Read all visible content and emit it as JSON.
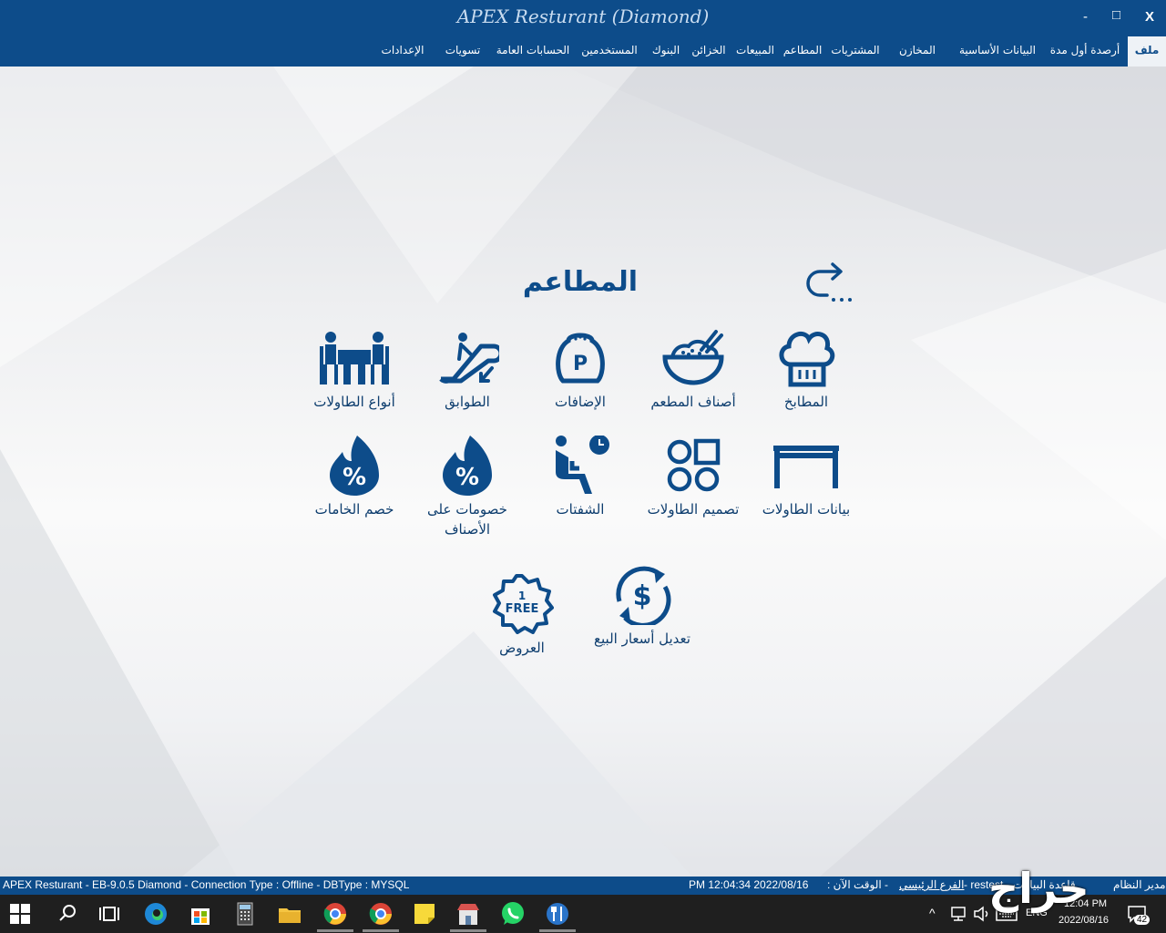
{
  "window": {
    "title": "APEX Resturant (Diamond)",
    "minimize": "-",
    "maximize": "□",
    "close": "X"
  },
  "menu": {
    "items": [
      "ملف",
      "أرصدة أول مدة",
      "البيانات الأساسية",
      "المخازن",
      "المشتريات",
      "المطاعم",
      "المبيعات",
      "الخزائن",
      "البنوك",
      "المستخدمين",
      "الحسابات العامة",
      "تسويات",
      "الإعدادات"
    ]
  },
  "page": {
    "title": "المطاعم",
    "back_icon": "back-arrow-icon"
  },
  "tiles": [
    {
      "label": "المطابخ",
      "icon": "chef-hat-icon"
    },
    {
      "label": "أصناف المطعم",
      "icon": "rice-bowl-icon"
    },
    {
      "label": "الإضافات",
      "icon": "pepper-shaker-icon"
    },
    {
      "label": "الطوابق",
      "icon": "escalator-icon"
    },
    {
      "label": "أنواع الطاولات",
      "icon": "dining-table-icon"
    },
    {
      "label": "بيانات الطاولات",
      "icon": "table-icon"
    },
    {
      "label": "تصميم الطاولات",
      "icon": "layout-shapes-icon"
    },
    {
      "label": "الشفتات",
      "icon": "seated-clock-icon"
    },
    {
      "label": "خصومات على الأصناف",
      "icon": "discount-drop-icon"
    },
    {
      "label": "خصم الخامات",
      "icon": "discount-drop-icon"
    },
    {
      "label": "تعديل أسعار البيع",
      "icon": "price-refresh-icon"
    },
    {
      "label": "العروض",
      "icon": "free-badge-icon",
      "badge_top": "1",
      "badge_text": "FREE"
    }
  ],
  "status": {
    "left": "APEX Resturant - EB-9.0.5  Diamond   -   Connection Type :  Offline   -   DBType :  MYSQL",
    "time_value": "PM 12:04:34 2022/08/16",
    "time_label": ": الوقت الآن  -",
    "branch": "الفرع الرئيسي",
    "db": "-   restest  -  قاعدة البيانات",
    "user": "مدير النظام"
  },
  "taskbar": {
    "language": "ENG",
    "clock_time": "12:04 PM",
    "clock_date": "2022/08/16",
    "notifications": "42"
  },
  "watermark": "حراج"
}
